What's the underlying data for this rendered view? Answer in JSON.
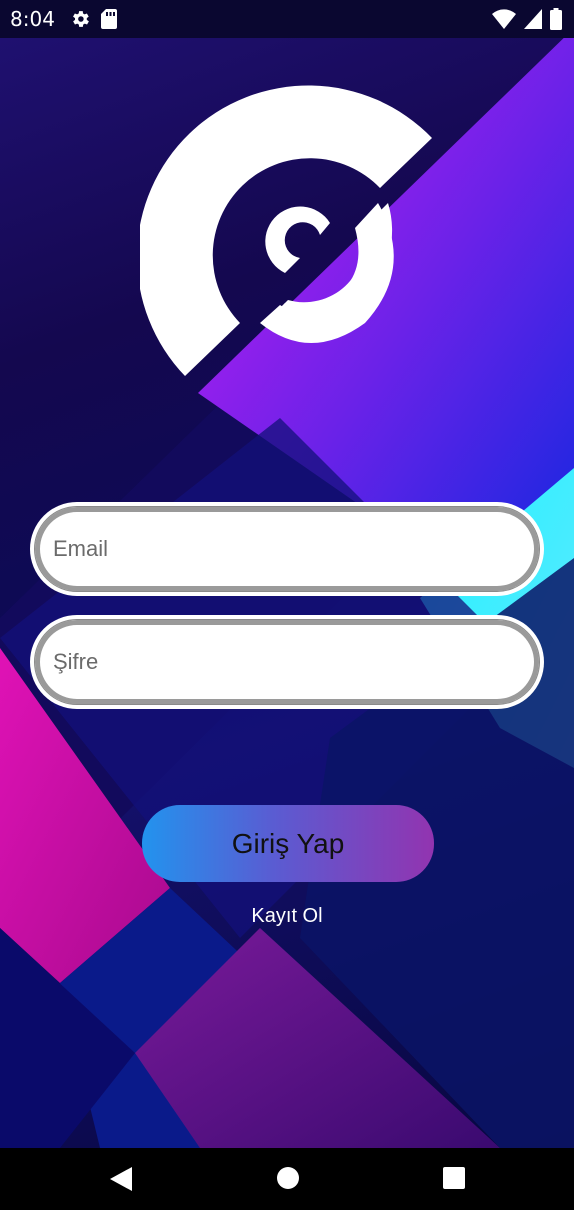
{
  "status_bar": {
    "time": "8:04",
    "left_icons": [
      "gear-icon",
      "sd-card-icon"
    ],
    "right_icons": [
      "wifi-icon",
      "cellular-signal-icon",
      "battery-icon"
    ]
  },
  "app": {
    "logo": "c-logo",
    "email_field": {
      "placeholder": "Email",
      "value": ""
    },
    "password_field": {
      "placeholder": "Şifre",
      "value": ""
    },
    "login_label": "Giriş Yap",
    "register_label": "Kayıt Ol"
  },
  "nav_bar": {
    "icons": [
      "back-triangle-icon",
      "home-circle-icon",
      "recents-square-icon"
    ]
  },
  "colors": {
    "login_gradient": [
      "#2293ee",
      "#9234b0"
    ],
    "background": "#14084f"
  }
}
